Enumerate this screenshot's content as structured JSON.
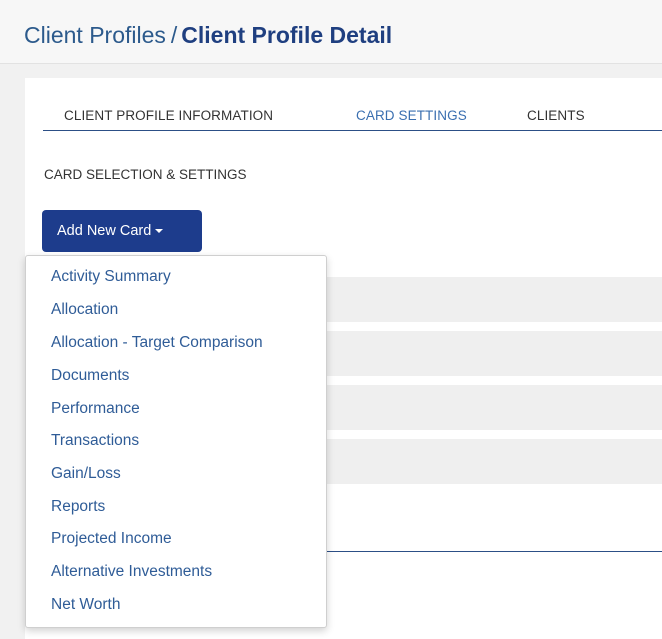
{
  "breadcrumb": {
    "parent": "Client Profiles",
    "separator": "/",
    "current": "Client Profile Detail"
  },
  "tabs": [
    {
      "label": "CLIENT PROFILE INFORMATION"
    },
    {
      "label": "CARD SETTINGS"
    },
    {
      "label": "CLIENTS"
    }
  ],
  "section_title": "CARD SELECTION & SETTINGS",
  "add_button": {
    "label": "Add New Card"
  },
  "dropdown": {
    "items": [
      "Activity Summary",
      "Allocation",
      "Allocation - Target Comparison",
      "Documents",
      "Performance",
      "Transactions",
      "Gain/Loss",
      "Reports",
      "Projected Income",
      "Alternative Investments",
      "Net Worth"
    ]
  },
  "colors": {
    "brand": "#1d3c8c",
    "link": "#2f5c97",
    "header_bg": "#f7f7f7",
    "page_bg": "#f1f1f1"
  }
}
